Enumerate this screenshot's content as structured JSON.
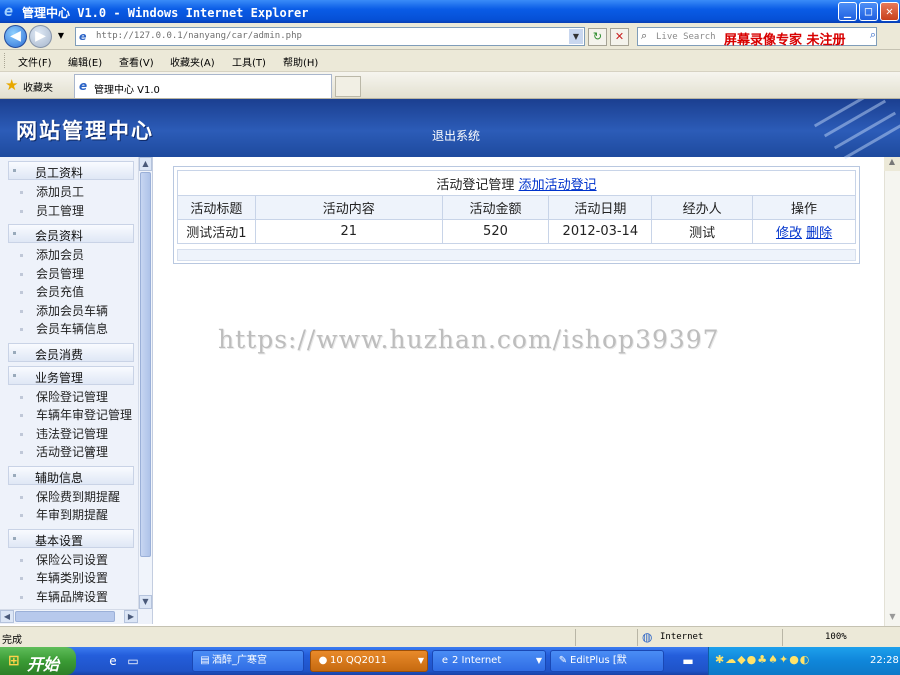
{
  "window": {
    "title": "管理中心 V1.0 - Windows Internet Explorer",
    "minimize": "_",
    "maximize": "□",
    "close": "✕"
  },
  "addressbar": {
    "back": "◀",
    "forward": "▶",
    "url": "http://127.0.0.1/nanyang/car/admin.php",
    "refresh": "↻",
    "stop": "✕",
    "search_placeholder": "Live Search",
    "recorder_watermark": "屏幕录像专家  未注册",
    "search_go": "⌕"
  },
  "menubar": {
    "items": [
      "文件(F)",
      "编辑(E)",
      "查看(V)",
      "收藏夹(A)",
      "工具(T)",
      "帮助(H)"
    ]
  },
  "favbar": {
    "favorites_label": "收藏夹",
    "tab_label": "管理中心 V1.0"
  },
  "banner": {
    "logo": "网站管理中心",
    "logout": "退出系统"
  },
  "sidebar": {
    "sections": [
      {
        "title": "员工资料",
        "items": [
          "添加员工",
          "员工管理"
        ]
      },
      {
        "title": "会员资料",
        "items": [
          "添加会员",
          "会员管理",
          "会员充值",
          "添加会员车辆",
          "会员车辆信息"
        ]
      },
      {
        "title": "会员消费",
        "items": []
      },
      {
        "title": "业务管理",
        "items": [
          "保险登记管理",
          "车辆年审登记管理",
          "违法登记管理",
          "活动登记管理"
        ]
      },
      {
        "title": "辅助信息",
        "items": [
          "保险费到期提醒",
          "年审到期提醒"
        ]
      },
      {
        "title": "基本设置",
        "items": [
          "保险公司设置",
          "车辆类别设置",
          "车辆品牌设置"
        ]
      }
    ]
  },
  "main": {
    "caption": "活动登记管理",
    "add_link": "添加活动登记",
    "columns": [
      "活动标题",
      "活动内容",
      "活动金额",
      "活动日期",
      "经办人",
      "操作"
    ],
    "rows": [
      {
        "title": "测试活动1",
        "content": "21",
        "amount": "520",
        "date": "2012-03-14",
        "handler": "测试",
        "edit": "修改",
        "delete": "删除"
      }
    ]
  },
  "overlay_watermark": "https://www.huzhan.com/ishop39397",
  "statusbar": {
    "status": "完成",
    "zone": "Internet",
    "zoom": "100%"
  },
  "taskbar": {
    "start": "开始",
    "tasks": [
      "酒醉_广寒宫",
      "10 QQ2011",
      "2 Internet",
      "EditPlus [默"
    ],
    "clock": "22:28"
  }
}
